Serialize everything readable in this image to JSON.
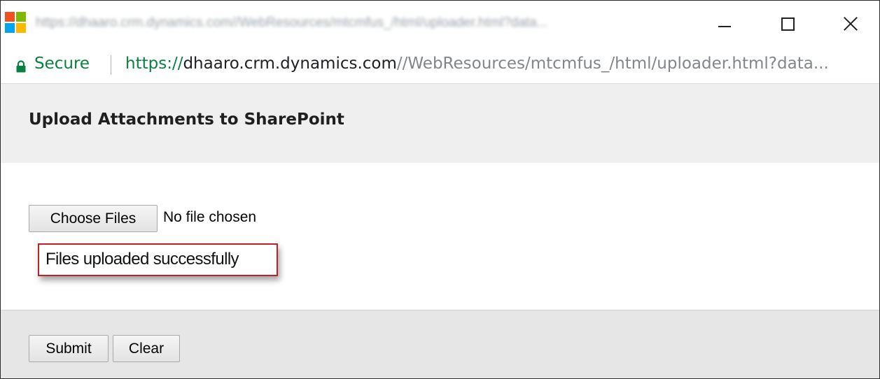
{
  "window": {
    "title_blurred": "https://dhaaro.crm.dynamics.com//WebResources/mtcmfus_/html/uploader.html?data...",
    "icon": "microsoft-logo-icon",
    "controls": {
      "minimize_icon": "minimize-icon",
      "maximize_icon": "maximize-icon",
      "close_icon": "close-icon"
    }
  },
  "address_bar": {
    "secure_label": "Secure",
    "lock_icon": "lock-icon",
    "url_scheme": "https://",
    "url_host": "dhaaro.crm.dynamics.com",
    "url_path": "//WebResources/mtcmfus_/html/uploader.html?data..."
  },
  "page": {
    "title": "Upload Attachments to SharePoint",
    "choose_files_label": "Choose Files",
    "no_file_text": "No file chosen",
    "status_message": "Files uploaded successfully",
    "submit_label": "Submit",
    "clear_label": "Clear"
  },
  "colors": {
    "secure_green": "#0b8043",
    "highlight_red": "#c0202a",
    "header_bg": "#efefef",
    "footer_bg": "#e6e6e6"
  }
}
